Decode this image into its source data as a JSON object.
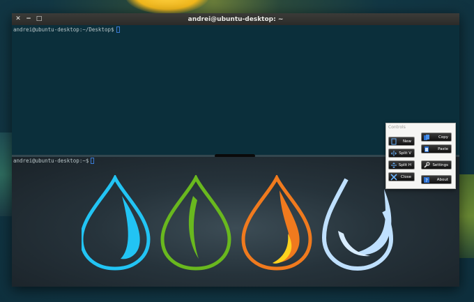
{
  "window": {
    "title": "andrei@ubuntu-desktop: ~",
    "buttons": {
      "close": "✕",
      "minimize": "−",
      "maximize": "□"
    }
  },
  "terminal": {
    "top_prompt": "andrei@ubuntu-desktop:~/Desktop$",
    "bottom_prompt": "andrei@ubuntu-desktop:~$"
  },
  "controls": {
    "title": "Controls",
    "buttons": {
      "new": "New",
      "copy": "Copy",
      "split_v": "Split V",
      "paste": "Paste",
      "split_h": "Split H",
      "settings": "Settings",
      "close": "Close",
      "about": "About"
    }
  },
  "colors": {
    "drop_blue": "#22c4f4",
    "drop_green": "#69b81e",
    "drop_orange": "#f07a1e",
    "drop_yellow": "#ffd21e",
    "drop_pale_blue": "#bfe0ff",
    "cursor": "#3a7bd5",
    "terminal_bg": "#0b2f3b"
  },
  "icons": [
    "new-icon",
    "copy-icon",
    "split-v-icon",
    "paste-icon",
    "split-h-icon",
    "settings-icon",
    "close-icon",
    "about-icon"
  ]
}
